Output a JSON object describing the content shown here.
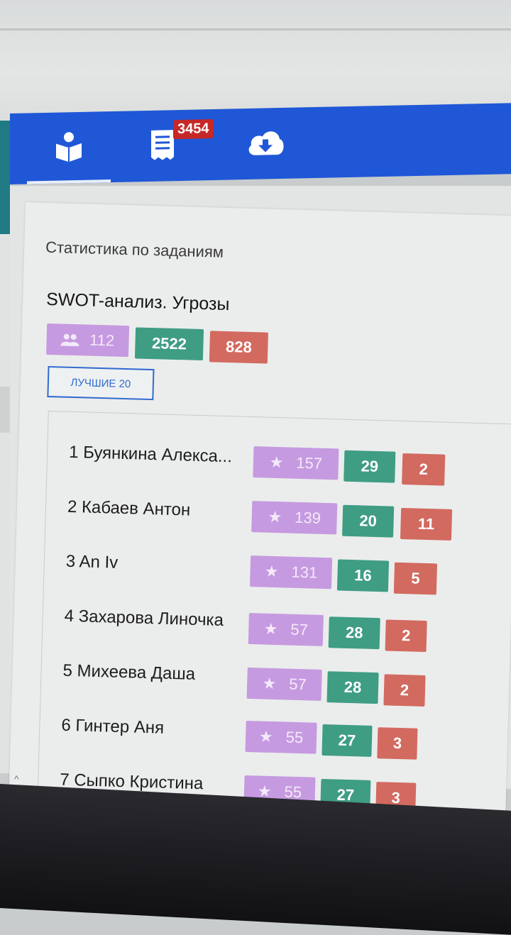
{
  "header": {
    "tabs": [
      {
        "icon": "reader-icon",
        "active": true
      },
      {
        "icon": "receipt-icon",
        "badge": "3454"
      },
      {
        "icon": "cloud-download-icon"
      }
    ]
  },
  "card": {
    "title": "Статистика по заданиям",
    "task_title": "SWOT-анализ. Угрозы",
    "stats": {
      "participants": "112",
      "green": "2522",
      "red": "828"
    },
    "best_button": "ЛУЧШИЕ 20"
  },
  "leaders": [
    {
      "name": "1 Буянкина Алекса...",
      "score": "157",
      "green": "29",
      "red": "2"
    },
    {
      "name": "2 Кабаев Антон",
      "score": "139",
      "green": "20",
      "red": "11"
    },
    {
      "name": "3 An Iv",
      "score": "131",
      "green": "16",
      "red": "5"
    },
    {
      "name": "4 Захарова Линочка",
      "score": "57",
      "green": "28",
      "red": "2"
    },
    {
      "name": "5 Михеева Даша",
      "score": "57",
      "green": "28",
      "red": "2"
    },
    {
      "name": "6 Гинтер Аня",
      "score": "55",
      "green": "27",
      "red": "3"
    },
    {
      "name": "7 Сыпко Кристина",
      "score": "55",
      "green": "27",
      "red": "3"
    }
  ],
  "colors": {
    "header": "#1f57d6",
    "purple": "#c69ae0",
    "green": "#3f9d84",
    "red": "#d26a60",
    "badge": "#c62828"
  }
}
